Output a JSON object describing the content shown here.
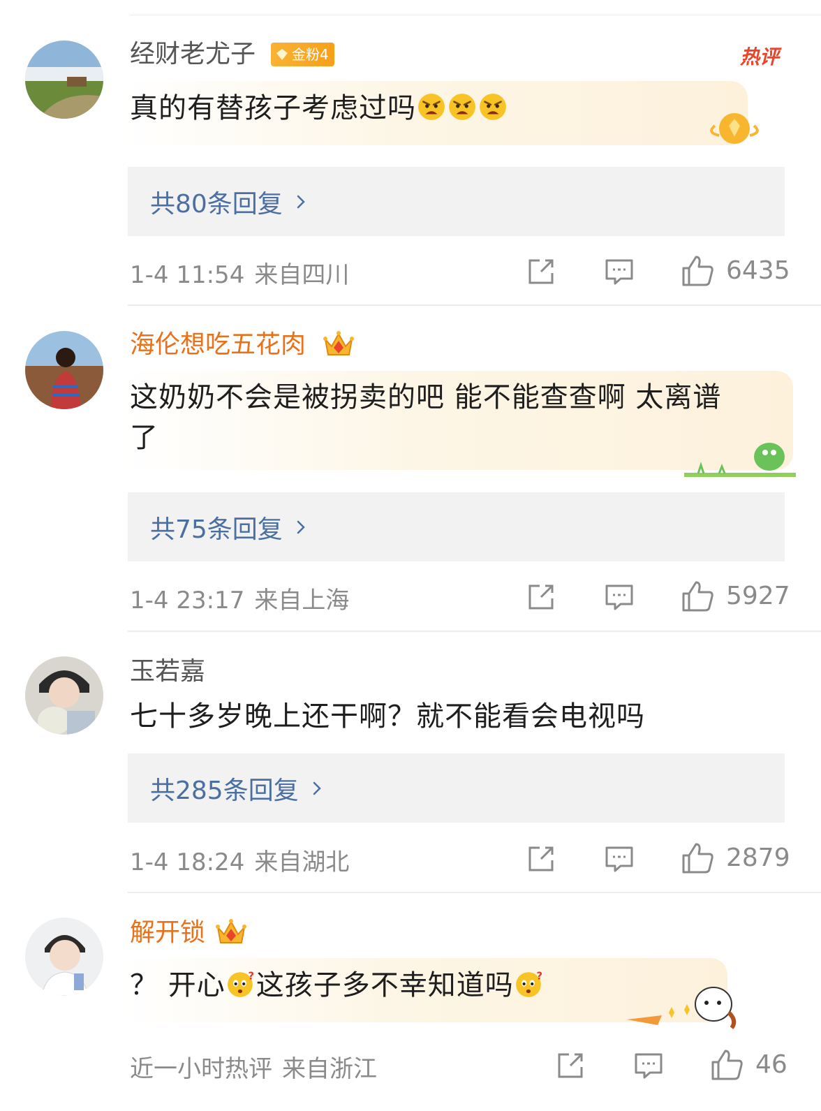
{
  "comments": [
    {
      "username": "经财老尤子",
      "fan_badge": "金粉4",
      "hot_tag": "热评",
      "text": "真的有替孩子考虑过吗",
      "replies": "共80条回复",
      "time": "1-4 11:54",
      "location": "来自四川",
      "likes": "6435",
      "emoji_icon": "angry-face-icon"
    },
    {
      "username": "海伦想吃五花肉",
      "text_line1": "这奶奶不会是被拐卖的吧 能不能查查啊 太离谱",
      "text_line2": "了",
      "replies": "共75条回复",
      "time": "1-4 23:17",
      "location": "来自上海",
      "likes": "5927"
    },
    {
      "username": "玉若嘉",
      "text": "七十多岁晚上还干啊？就不能看会电视吗",
      "replies": "共285条回复",
      "time": "1-4 18:24",
      "location": "来自湖北",
      "likes": "2879"
    },
    {
      "username": "解开锁",
      "text_a": "？ 开心",
      "text_b": "这孩子多不幸知道吗",
      "time": "近一小时热评",
      "location": "来自浙江",
      "likes": "46",
      "emoji_icon": "wondering-face-icon"
    }
  ],
  "colors": {
    "reply_link": "#4a6fa0",
    "vip_name": "#e8711a",
    "hot_tag": "#e8452a",
    "meta_text": "#8a8a8a"
  }
}
